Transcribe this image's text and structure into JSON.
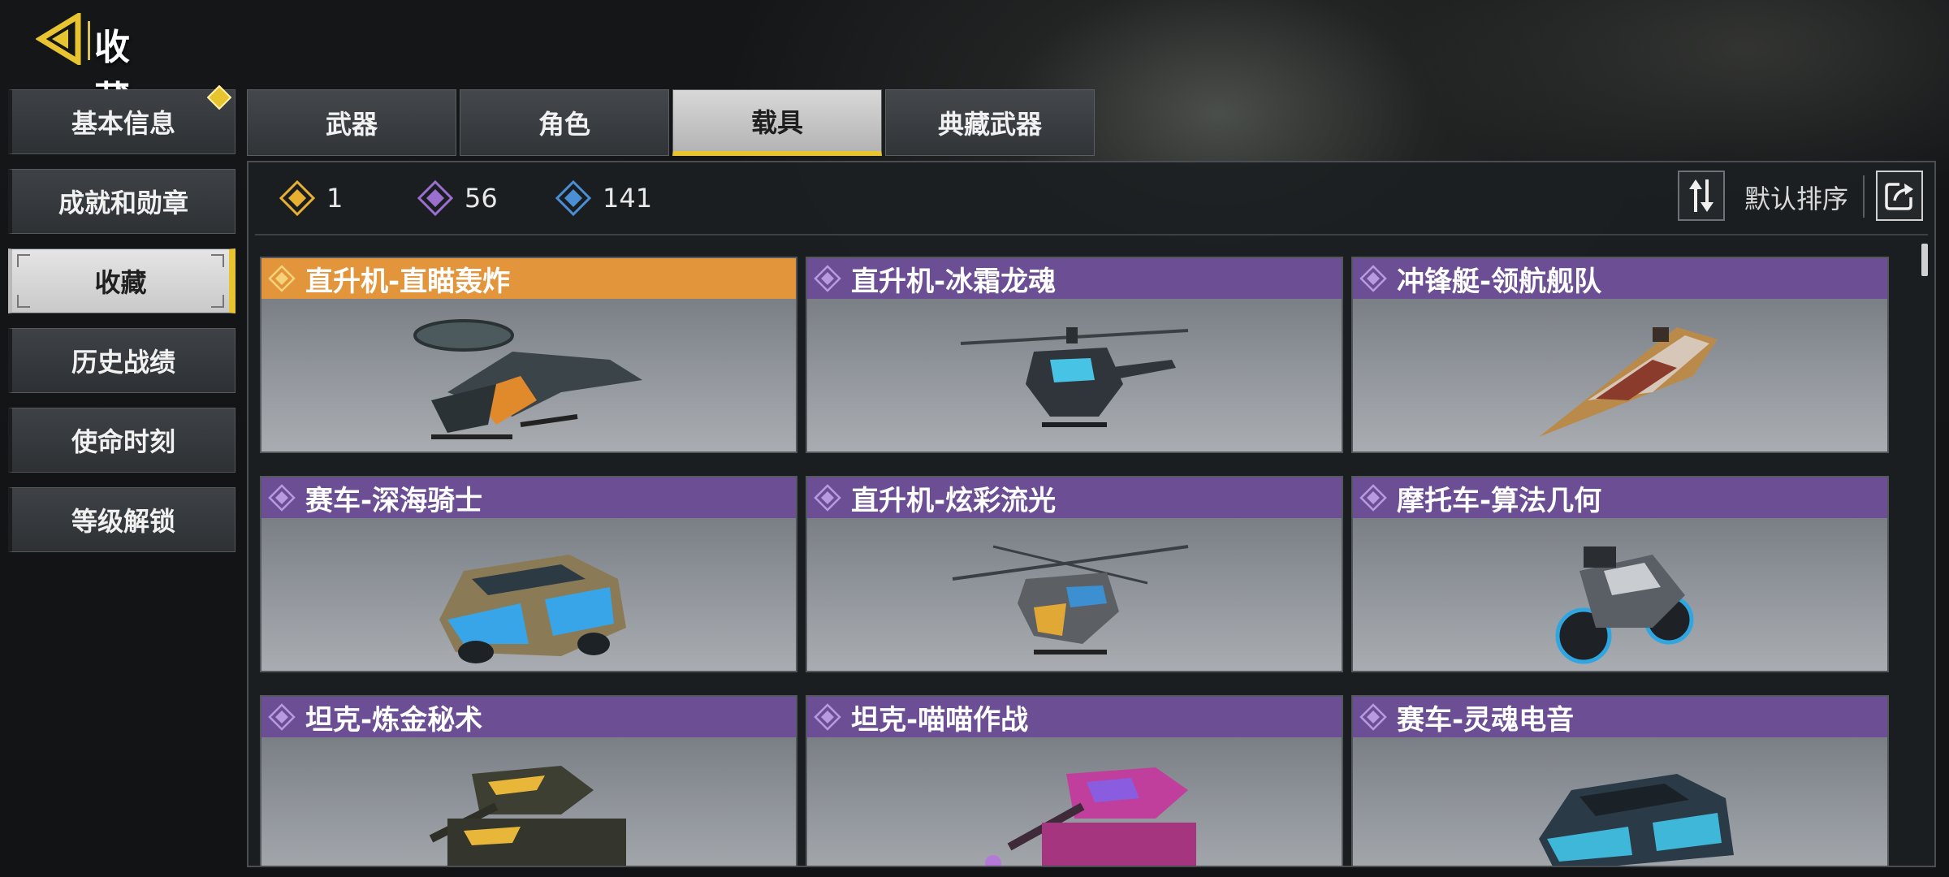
{
  "header": {
    "title": "收藏"
  },
  "sidebar": {
    "items": [
      {
        "label": "基本信息"
      },
      {
        "label": "成就和勋章"
      },
      {
        "label": "收藏"
      },
      {
        "label": "历史战绩"
      },
      {
        "label": "使命时刻"
      },
      {
        "label": "等级解锁"
      }
    ],
    "active_index": 2
  },
  "tabs": [
    {
      "label": "武器"
    },
    {
      "label": "角色"
    },
    {
      "label": "载具"
    },
    {
      "label": "典藏武器"
    }
  ],
  "active_tab": 2,
  "counts": {
    "gold": "1",
    "purple": "56",
    "blue": "141"
  },
  "toolbar": {
    "sort_label": "默认排序"
  },
  "items": [
    {
      "name": "直升机-直瞄轰炸",
      "rarity": "gold",
      "icon": "helicopter-icon"
    },
    {
      "name": "直升机-冰霜龙魂",
      "rarity": "purple",
      "icon": "helicopter-icon"
    },
    {
      "name": "冲锋艇-领航舰队",
      "rarity": "purple",
      "icon": "boat-icon"
    },
    {
      "name": "赛车-深海骑士",
      "rarity": "purple",
      "icon": "car-icon"
    },
    {
      "name": "直升机-炫彩流光",
      "rarity": "purple",
      "icon": "helicopter-icon"
    },
    {
      "name": "摩托车-算法几何",
      "rarity": "purple",
      "icon": "motorcycle-icon"
    },
    {
      "name": "坦克-炼金秘术",
      "rarity": "purple",
      "icon": "tank-icon"
    },
    {
      "name": "坦克-喵喵作战",
      "rarity": "purple",
      "icon": "tank-icon"
    },
    {
      "name": "赛车-灵魂电音",
      "rarity": "purple",
      "icon": "car-icon"
    }
  ],
  "colors": {
    "accent": "#e8c530",
    "legendary": "#e3953b",
    "epic": "#6b4e94",
    "rare": "#4a8fd6"
  }
}
